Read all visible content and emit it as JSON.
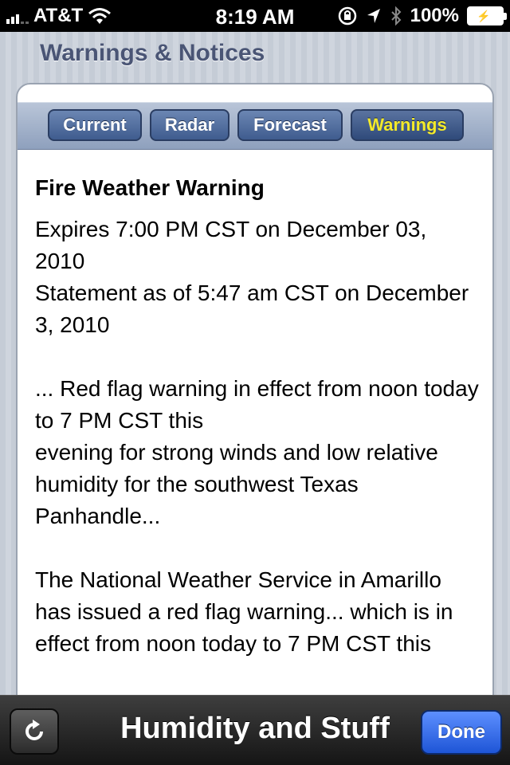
{
  "status_bar": {
    "carrier": "AT&T",
    "time": "8:19 AM",
    "battery": "100%",
    "icons": [
      "signal-icon",
      "wifi-icon",
      "rotation-lock-icon",
      "location-icon",
      "bluetooth-icon",
      "battery-icon"
    ]
  },
  "page_title": "Warnings & Notices",
  "tabs": [
    {
      "label": "Current",
      "active": false
    },
    {
      "label": "Radar",
      "active": false
    },
    {
      "label": "Forecast",
      "active": false
    },
    {
      "label": "Warnings",
      "active": true
    }
  ],
  "warning": {
    "title": "Fire Weather Warning",
    "paragraphs": [
      "Expires 7:00 PM CST on December 03, 2010\nStatement as of 5:47 am CST on December 3, 2010",
      "... Red flag warning in effect from noon today to 7 PM CST this\nevening for strong winds and low relative humidity for the southwest Texas Panhandle...",
      "The National Weather Service in Amarillo has issued a red flag warning... which is in effect from noon today to 7 PM CST this"
    ]
  },
  "toolbar": {
    "refresh_icon": "refresh-icon",
    "title": "Humidity and Stuff",
    "done_label": "Done"
  },
  "colors": {
    "active_tab_text": "#f3ea2a",
    "done_button": "#2a62e0",
    "title_text": "#4a5575"
  }
}
